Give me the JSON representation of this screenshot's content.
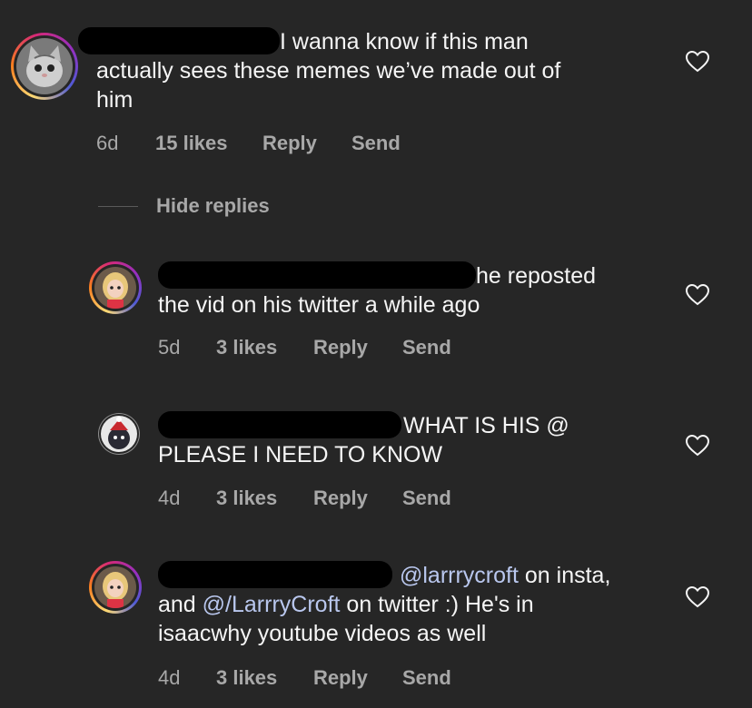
{
  "comments": [
    {
      "text_line1": "I wanna know if this man",
      "text_line2": "actually sees these memes we’ve made out of",
      "text_line3": "him",
      "time": "6d",
      "likes": "15 likes",
      "reply": "Reply",
      "send": "Send"
    },
    {
      "text_line1": "he reposted",
      "text_line2": "the vid on his twitter a while ago",
      "time": "5d",
      "likes": "3 likes",
      "reply": "Reply",
      "send": "Send"
    },
    {
      "text_line1": "WHAT IS HIS @",
      "text_line2": "PLEASE I NEED TO KNOW",
      "time": "4d",
      "likes": "3 likes",
      "reply": "Reply",
      "send": "Send"
    },
    {
      "mention1": "@larrrycroft",
      "text_line1_rest": " on insta,",
      "line2_pre": "and ",
      "mention2": "@/LarrryCroft",
      "line2_rest": " on twitter :) He's in",
      "text_line3": "isaacwhy youtube videos as well",
      "time": "4d",
      "likes": "3 likes",
      "reply": "Reply",
      "send": "Send"
    }
  ],
  "hide_replies": "Hide replies",
  "colors": {
    "background": "#262626",
    "text": "#f5f5f5",
    "secondary": "#a8a8a8",
    "mention": "#b9c7ee"
  },
  "icons": [
    "heart-icon",
    "avatar"
  ]
}
